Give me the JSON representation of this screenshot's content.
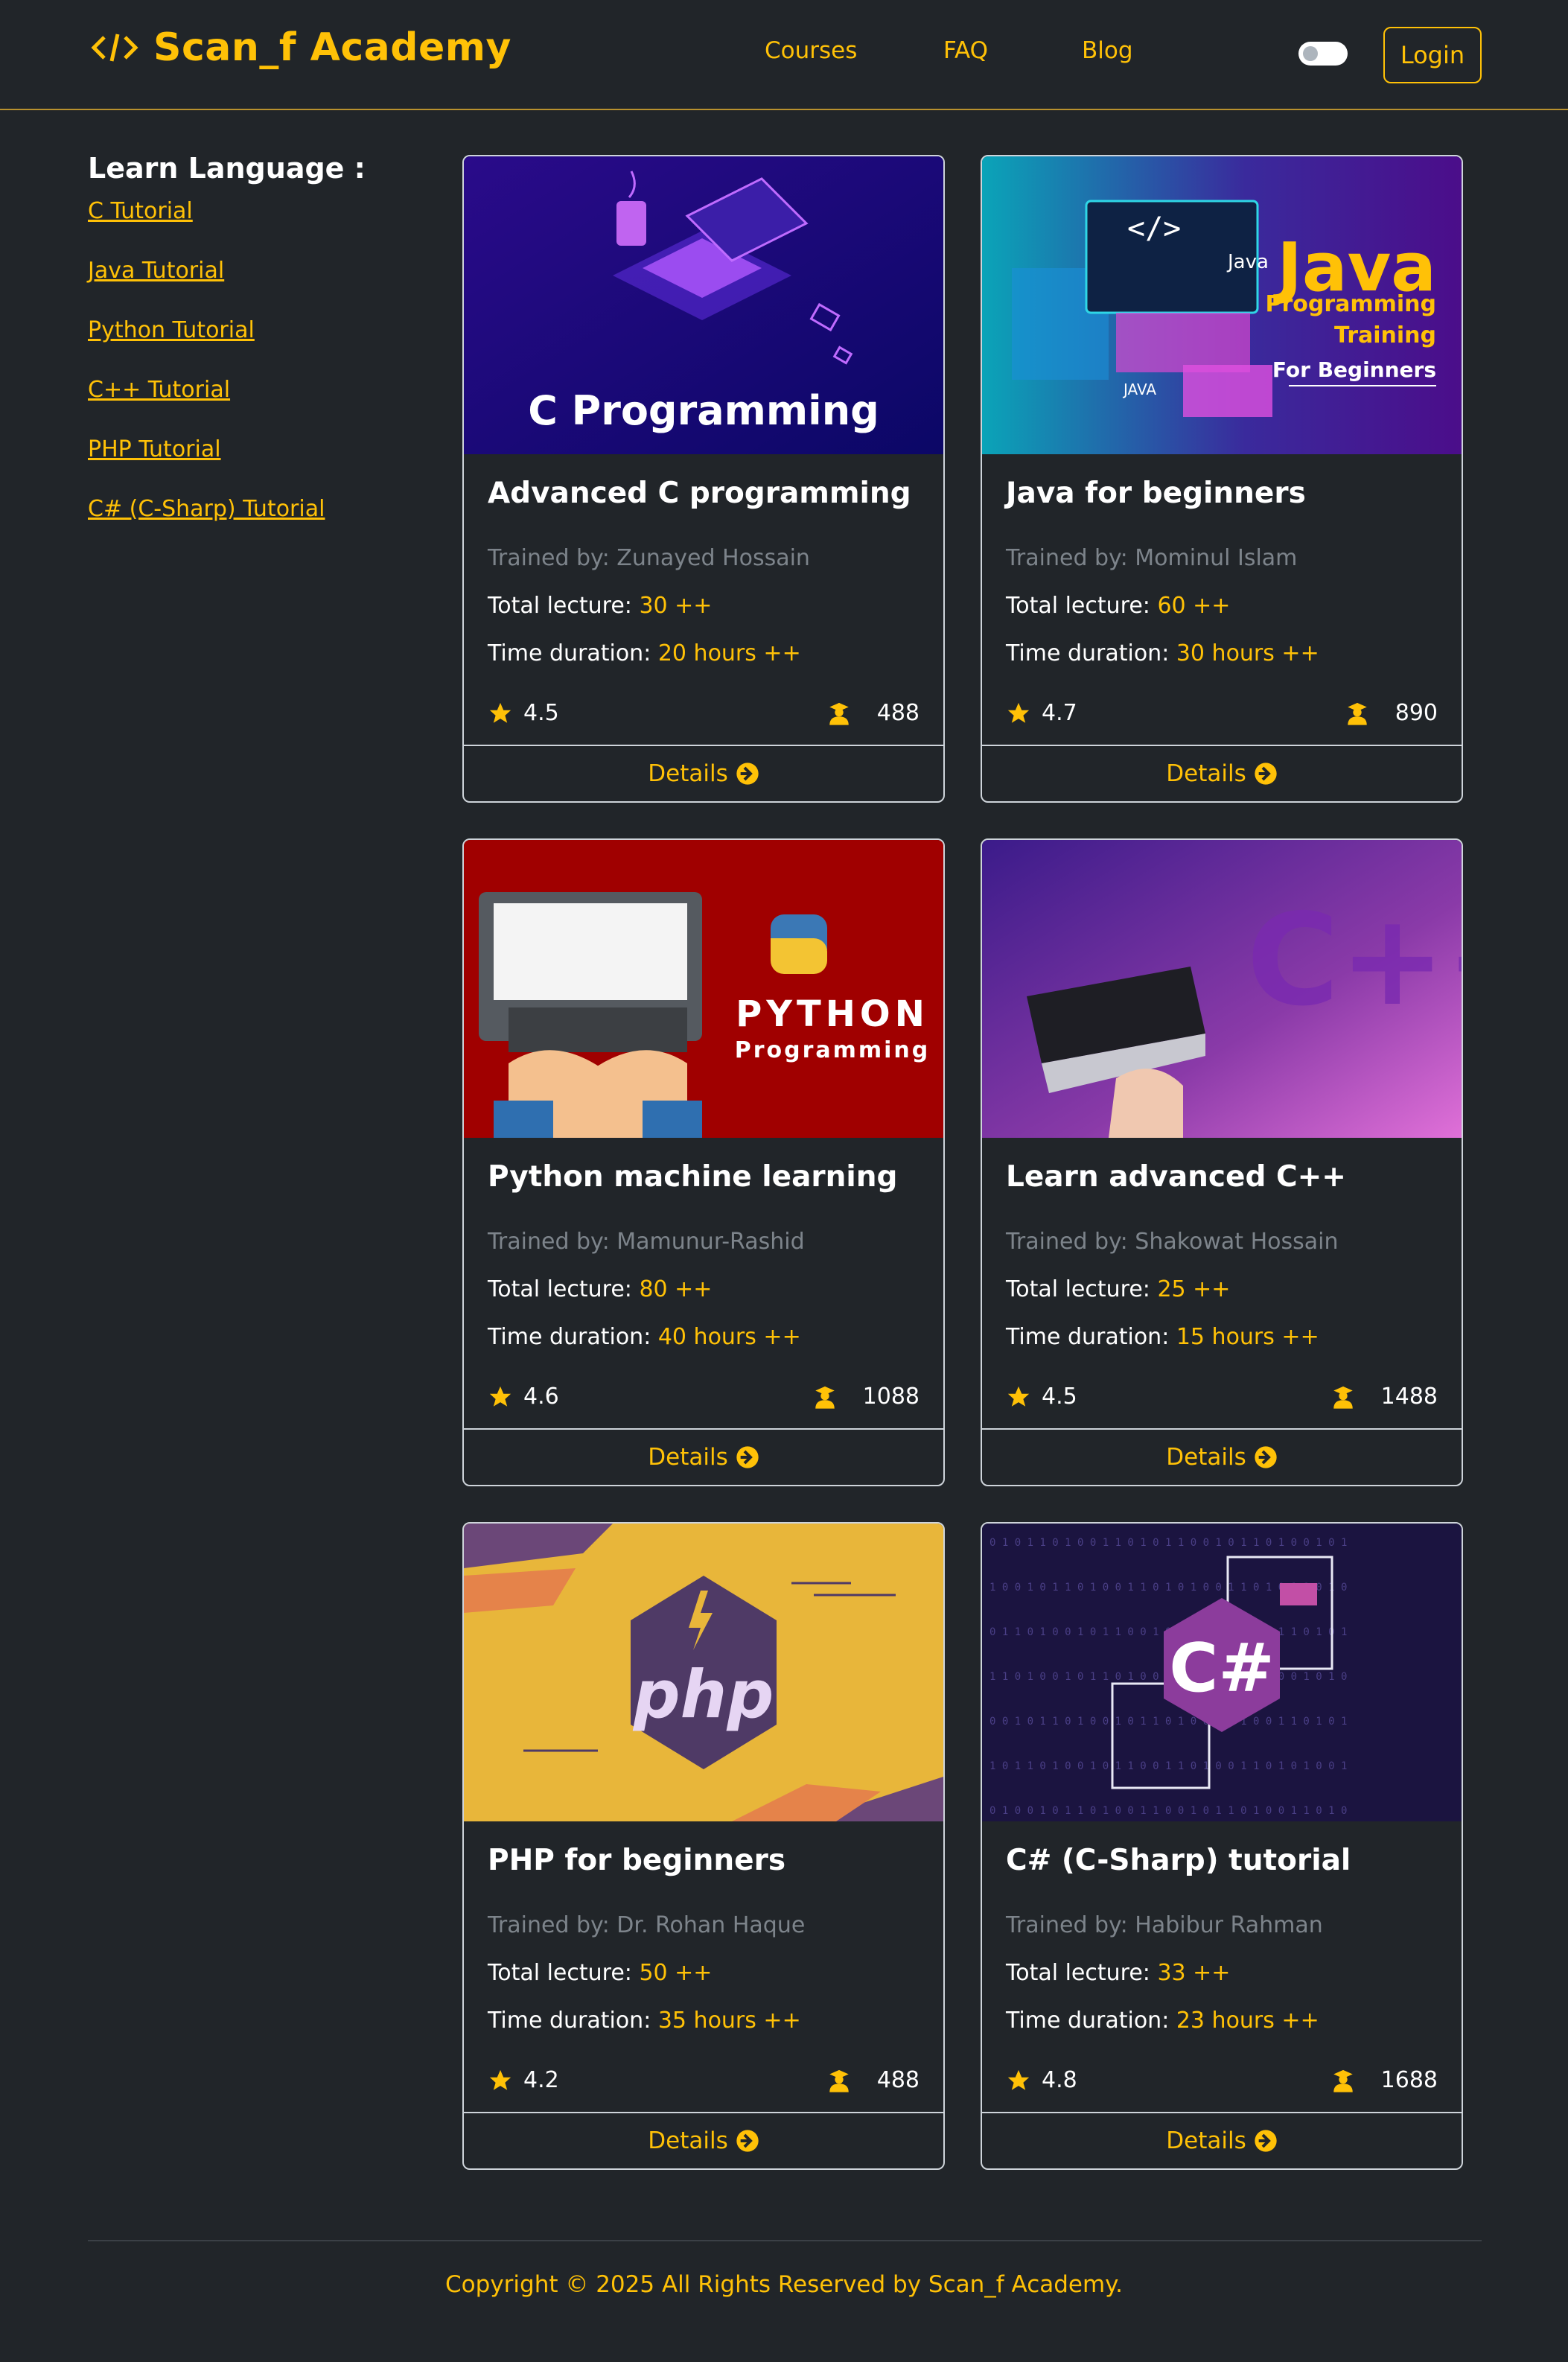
{
  "brand": {
    "name": "Scan_f Academy",
    "icon": "code-brackets-icon"
  },
  "nav": {
    "links": [
      "Courses",
      "FAQ",
      "Blog"
    ],
    "login_label": "Login",
    "theme_toggle": "off"
  },
  "sidebar": {
    "title": "Learn Language :",
    "links": [
      "C Tutorial",
      "Java Tutorial",
      "Python Tutorial",
      "C++ Tutorial",
      "PHP Tutorial",
      "C# (C-Sharp) Tutorial"
    ]
  },
  "labels": {
    "trained_by": "Trained by: ",
    "total_lecture": "Total lecture: ",
    "time_duration": "Time duration: ",
    "details": "Details"
  },
  "courses": [
    {
      "title": "Advanced C programming",
      "trainer": "Zunayed Hossain",
      "lectures": "30 ++",
      "duration": "20 hours ++",
      "rating": "4.5",
      "students": "488",
      "image_text": "C Programming"
    },
    {
      "title": "Java for beginners",
      "trainer": "Mominul Islam",
      "lectures": "60 ++",
      "duration": "30 hours ++",
      "rating": "4.7",
      "students": "890",
      "image_text": [
        "Java",
        "Programming",
        "Training",
        "For Beginners",
        "Java",
        "JAVA"
      ]
    },
    {
      "title": "Python machine learning",
      "trainer": "Mamunur-Rashid",
      "lectures": "80 ++",
      "duration": "40 hours ++",
      "rating": "4.6",
      "students": "1088",
      "image_text": [
        "PYTHON",
        "Programming"
      ]
    },
    {
      "title": "Learn advanced C++",
      "trainer": "Shakowat Hossain",
      "lectures": "25 ++",
      "duration": "15 hours ++",
      "rating": "4.5",
      "students": "1488",
      "image_text": "C++"
    },
    {
      "title": "PHP for beginners",
      "trainer": "Dr. Rohan Haque",
      "lectures": "50 ++",
      "duration": "35 hours ++",
      "rating": "4.2",
      "students": "488",
      "image_text": "php"
    },
    {
      "title": "C# (C-Sharp) tutorial",
      "trainer": "Habibur Rahman",
      "lectures": "33 ++",
      "duration": "23 hours ++",
      "rating": "4.8",
      "students": "1688",
      "image_text": "C#"
    }
  ],
  "footer": {
    "copyright": "Copyright © 2025 All Rights Reserved by Scan_f Academy."
  },
  "colors": {
    "background": "#212529",
    "accent": "#ffc107",
    "muted": "#7d848b",
    "border": "#ced4da"
  }
}
